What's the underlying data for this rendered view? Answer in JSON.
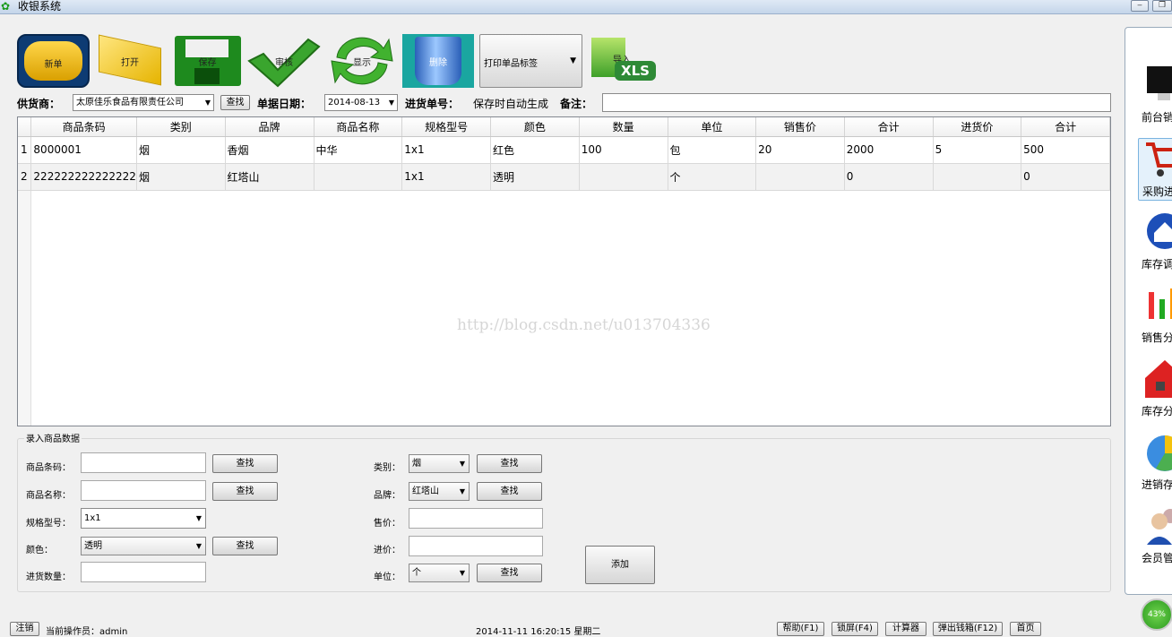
{
  "window": {
    "title": "收银系统"
  },
  "toolbar": {
    "new_label": "新单",
    "open_label": "打开",
    "save_label": "保存",
    "audit_label": "审核",
    "show_label": "显示",
    "delete_label": "删除",
    "print_label": "打印单品标签",
    "import_label": "导入"
  },
  "info": {
    "supplier_label": "供货商：",
    "supplier_value": "太原佳乐食品有限责任公司",
    "supplier_find": "查找",
    "date_label": "单据日期：",
    "date_value": "2014-08-13",
    "order_label": "进货单号：",
    "order_value": "保存时自动生成",
    "remark_label": "备注：",
    "remark_value": ""
  },
  "grid": {
    "columns": [
      "商品条码",
      "类别",
      "品牌",
      "商品名称",
      "规格型号",
      "颜色",
      "数量",
      "单位",
      "销售价",
      "合计",
      "进货价",
      "合计"
    ],
    "rows": [
      [
        "1",
        "8000001",
        "烟",
        "香烟",
        "中华",
        "1x1",
        "红色",
        "100",
        "包",
        "20",
        "2000",
        "5",
        "500"
      ],
      [
        "2",
        "222222222222222",
        "烟",
        "红塔山",
        "",
        "1x1",
        "透明",
        "",
        "个",
        "",
        "0",
        "",
        "0"
      ]
    ],
    "watermark": "http://blog.csdn.net/u013704336"
  },
  "entry": {
    "legend": "录入商品数据",
    "barcode_label": "商品条码：",
    "barcode_value": "",
    "name_label": "商品名称：",
    "name_value": "",
    "spec_label": "规格型号：",
    "spec_value": "1x1",
    "color_label": "颜色：",
    "color_value": "透明",
    "qty_label": "进货数量：",
    "qty_value": "",
    "category_label": "类别：",
    "category_value": "烟",
    "brand_label": "品牌：",
    "brand_value": "红塔山",
    "price_label": "售价：",
    "price_value": "",
    "cost_label": "进价：",
    "cost_value": "",
    "unit_label": "单位：",
    "unit_value": "个",
    "find_label": "查找",
    "add_label": "添加"
  },
  "status": {
    "logout": "注销",
    "operator": "当前操作员：admin",
    "datetime": "2014-11-11 16:20:15 星期二",
    "help": "帮助(F1)",
    "lock": "锁屏(F4)",
    "calc": "计算器",
    "cashbox": "弹出钱箱(F12)",
    "home": "首页"
  },
  "nav": {
    "items": [
      "前台销",
      "采购进",
      "库存调",
      "销售分",
      "库存分",
      "进销存",
      "会员管"
    ]
  },
  "gauge": {
    "value": "43%"
  }
}
